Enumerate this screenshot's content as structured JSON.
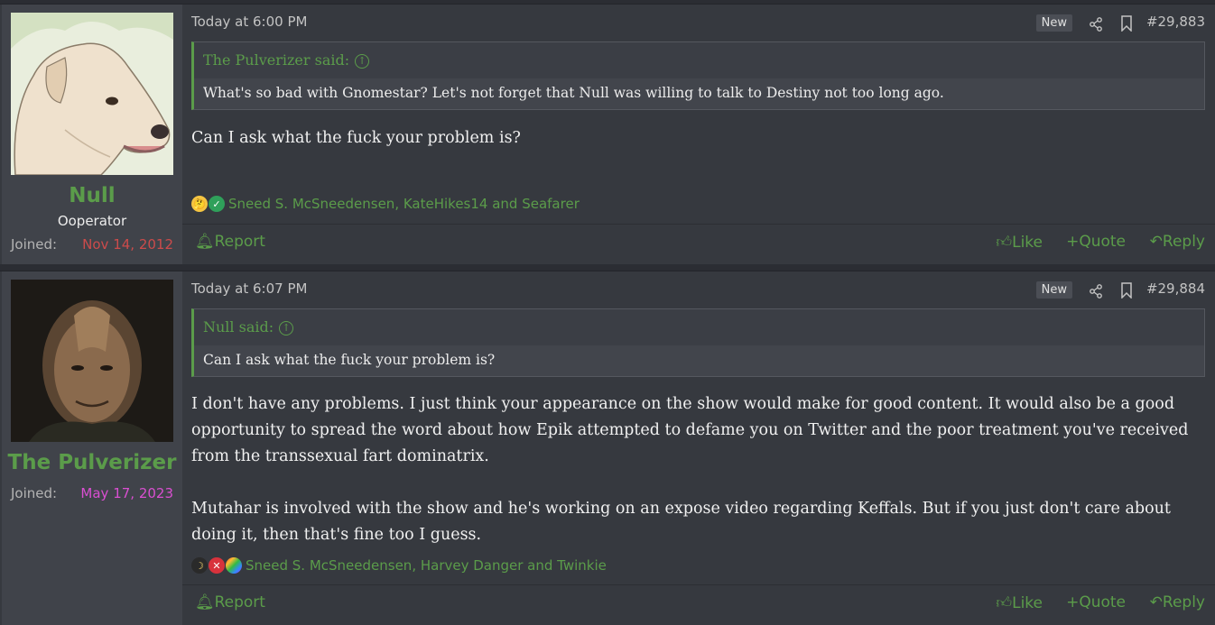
{
  "posts": [
    {
      "user": {
        "name": "Null",
        "title": "Ooperator",
        "joined_label": "Joined:",
        "joined": "Nov 14, 2012",
        "joined_color": "#cc4b4b"
      },
      "timestamp": "Today at 6:00 PM",
      "badge": "New",
      "number": "#29,883",
      "quote": {
        "author": "The Pulverizer said:",
        "text": "What's so bad with Gnomestar? Let's not forget that Null was willing to talk to Destiny not too long ago."
      },
      "body": [
        "Can I ask what the fuck your problem is?"
      ],
      "reactions": {
        "icons": [
          "thinking-icon",
          "check-icon"
        ],
        "names": "Sneed S. McSneedensen, KateHikes14 and Seafarer"
      },
      "actions": {
        "report": "Report",
        "like": "Like",
        "quote": "Quote",
        "reply": "Reply"
      }
    },
    {
      "user": {
        "name": "The Pulverizer",
        "title": "",
        "joined_label": "Joined:",
        "joined": "May 17, 2023",
        "joined_color": "#d94fd1"
      },
      "timestamp": "Today at 6:07 PM",
      "badge": "New",
      "number": "#29,884",
      "quote": {
        "author": "Null said:",
        "text": "Can I ask what the fuck your problem is?"
      },
      "body": [
        "I don't have any problems. I just think your appearance on the show would make for good content. It would also be a good opportunity to spread the word about how Epik attempted to defame you on Twitter and the poor treatment you've received from the transsexual fart dominatrix.",
        "Mutahar is involved with the show and he's working on an expose video regarding Keffals. But if you just don't care about doing it, then that's fine too I guess."
      ],
      "reactions": {
        "icons": [
          "moon-icon",
          "x-icon",
          "rainbow-icon"
        ],
        "names": "Sneed S. McSneedensen, Harvey Danger and Twinkie"
      },
      "actions": {
        "report": "Report",
        "like": "Like",
        "quote": "Quote",
        "reply": "Reply"
      }
    }
  ]
}
